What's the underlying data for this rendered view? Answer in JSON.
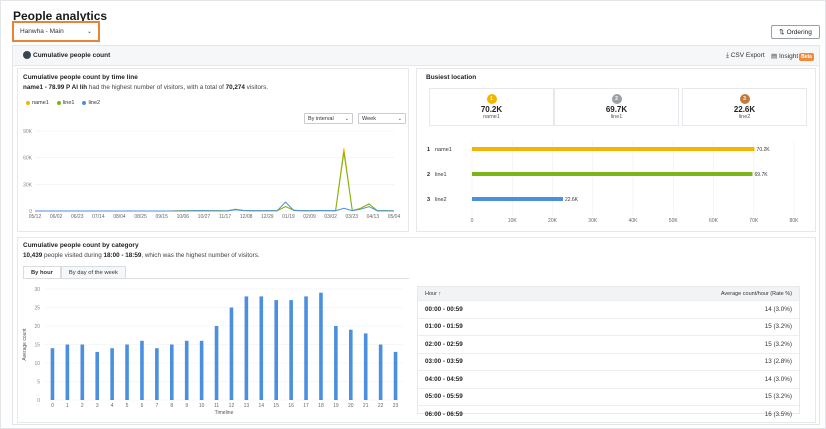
{
  "header": {
    "title": "People analytics",
    "site_select": "Hanwha - Main",
    "ordering_label": "Ordering"
  },
  "panel": {
    "title": "Cumulative people count",
    "csv_label": "CSV Export",
    "insight_label": "Insight",
    "beta_label": "Beta"
  },
  "timeline": {
    "title": "Cumulative people count by time line",
    "summary_prefix": "name1 - 78.99 P Al lih",
    "summary_mid": " had the highest number of visitors, with a total of ",
    "summary_value": "70,274",
    "summary_suffix": " visitors.",
    "interval_select": "By interval",
    "period_select": "Week"
  },
  "busiest": {
    "title": "Busiest location",
    "ranks": [
      {
        "rank": "1",
        "value": "70.2K",
        "name": "name1"
      },
      {
        "rank": "2",
        "value": "69.7K",
        "name": "line1"
      },
      {
        "rank": "3",
        "value": "22.6K",
        "name": "line2"
      }
    ]
  },
  "category": {
    "title": "Cumulative people count by category",
    "summary_value": "10,439",
    "summary_mid": " people visited during ",
    "summary_time": "18:00 - 18:59",
    "summary_suffix": ", which was the highest number of visitors.",
    "tabs": [
      "By hour",
      "By day of the week"
    ],
    "table_header_hour": "Hour",
    "table_header_avg": "Average count/hour (Rate %)",
    "rows": [
      {
        "hour": "00:00 - 00:59",
        "value": "14 (3.0%)"
      },
      {
        "hour": "01:00 - 01:59",
        "value": "15 (3.2%)"
      },
      {
        "hour": "02:00 - 02:59",
        "value": "15 (3.2%)"
      },
      {
        "hour": "03:00 - 03:59",
        "value": "13 (2.8%)"
      },
      {
        "hour": "04:00 - 04:59",
        "value": "14 (3.0%)"
      },
      {
        "hour": "05:00 - 05:59",
        "value": "15 (3.2%)"
      },
      {
        "hour": "06:00 - 06:59",
        "value": "16 (3.5%)"
      }
    ]
  },
  "colors": {
    "name1": "#f5b400",
    "line1": "#7cb518",
    "line2": "#4a8fe0",
    "accent": "#e8833a"
  },
  "chart_data": [
    {
      "type": "line",
      "x": [
        "05/12",
        "06/02",
        "06/23",
        "07/14",
        "08/04",
        "08/25",
        "09/15",
        "10/06",
        "10/27",
        "11/17",
        "12/08",
        "12/29",
        "01/19",
        "02/09",
        "03/02",
        "03/23",
        "04/13",
        "05/04"
      ],
      "series": [
        {
          "name": "name1",
          "values": [
            0,
            0,
            0,
            0,
            0,
            0,
            0,
            0,
            0,
            0,
            0,
            0,
            0,
            0,
            0,
            0,
            0,
            500,
            200,
            300,
            400,
            300,
            200,
            100,
            2000,
            600,
            200,
            300,
            200,
            200,
            5000,
            1000,
            300,
            300,
            500,
            500,
            300,
            70274,
            500,
            3000,
            8000,
            300,
            200,
            100
          ]
        },
        {
          "name": "line1",
          "values": [
            0,
            0,
            0,
            0,
            0,
            0,
            0,
            0,
            0,
            0,
            0,
            0,
            0,
            0,
            0,
            0,
            0,
            0,
            200,
            300,
            400,
            300,
            200,
            100,
            2000,
            600,
            200,
            300,
            200,
            200,
            5000,
            800,
            300,
            300,
            500,
            500,
            300,
            66000,
            500,
            3000,
            8000,
            300,
            200,
            100
          ]
        },
        {
          "name": "line2",
          "values": [
            0,
            0,
            0,
            0,
            0,
            0,
            0,
            0,
            0,
            0,
            0,
            0,
            0,
            0,
            0,
            0,
            0,
            0,
            100,
            200,
            300,
            200,
            100,
            100,
            1500,
            400,
            200,
            300,
            200,
            200,
            10000,
            600,
            300,
            300,
            400,
            400,
            300,
            3000,
            500,
            2000,
            5000,
            300,
            200,
            100
          ]
        }
      ],
      "y_ticks": [
        "0",
        "30K",
        "60K",
        "90K"
      ],
      "ylim": [
        0,
        90000
      ]
    },
    {
      "type": "bar",
      "orientation": "horizontal",
      "categories": [
        "name1",
        "line1",
        "line2"
      ],
      "ranks": [
        "1",
        "2",
        "3"
      ],
      "values": [
        70200,
        69700,
        22600
      ],
      "data_labels": [
        "70.2K",
        "69.7K",
        "22.6K"
      ],
      "x_ticks": [
        "0",
        "10K",
        "20K",
        "30K",
        "40K",
        "50K",
        "60K",
        "70K",
        "80K"
      ],
      "xlim": [
        0,
        80000
      ]
    },
    {
      "type": "bar",
      "categories": [
        "0",
        "1",
        "2",
        "3",
        "4",
        "5",
        "6",
        "7",
        "8",
        "9",
        "10",
        "11",
        "12",
        "13",
        "14",
        "15",
        "16",
        "17",
        "18",
        "19",
        "20",
        "21",
        "22",
        "23"
      ],
      "values": [
        14,
        15,
        15,
        13,
        14,
        15,
        16,
        14,
        15,
        16,
        16,
        20,
        25,
        28,
        28,
        27,
        27,
        28,
        29,
        20,
        19,
        18,
        15,
        13
      ],
      "xlabel": "Timeline",
      "ylabel": "Average count",
      "y_ticks": [
        "0",
        "5",
        "10",
        "15",
        "20",
        "25",
        "30"
      ],
      "ylim": [
        0,
        30
      ]
    }
  ]
}
